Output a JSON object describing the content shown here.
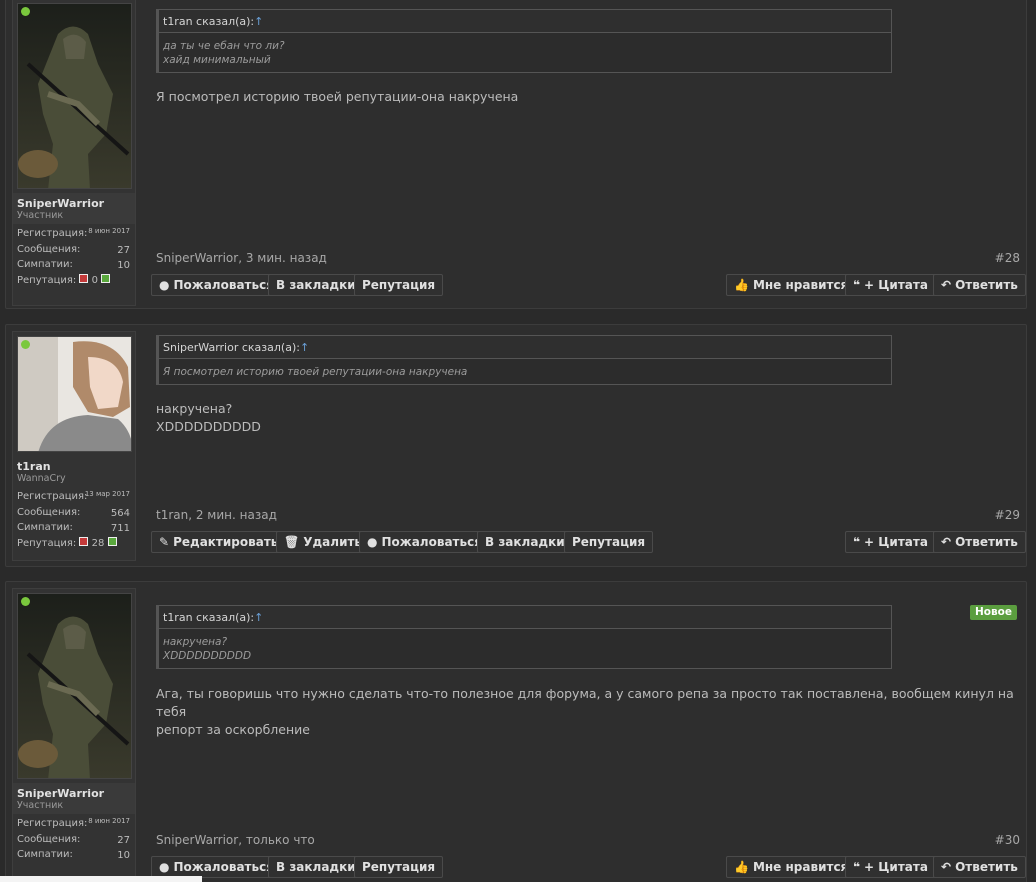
{
  "posts": [
    {
      "user": {
        "name": "SniperWarrior",
        "title": "Участник",
        "reg_label": "Регистрация:",
        "reg_date": "8 июн 2017",
        "msgs_label": "Сообщения:",
        "msgs": "27",
        "likes_label": "Симпатии:",
        "likes": "10",
        "rep_label": "Репутация:",
        "rep": "0"
      },
      "quote": {
        "author": "t1ran сказал(а):",
        "arrow": "↑",
        "lines": [
          "да ты че ебан что ли?",
          "хайд минимальный"
        ]
      },
      "message": [
        "Я посмотрел историю твоей репутации-она накручена"
      ],
      "meta": "SniperWarrior, 3 мин. назад",
      "number": "#28",
      "left_buttons": [
        "Пожаловаться",
        "В закладки",
        "Репутация"
      ],
      "right_buttons": [
        "Мне нравится",
        "+ Цитата",
        "Ответить"
      ]
    },
    {
      "user": {
        "name": "t1ran",
        "title": "WannaCry",
        "reg_label": "Регистрация:",
        "reg_date": "13 мар 2017",
        "msgs_label": "Сообщения:",
        "msgs": "564",
        "likes_label": "Симпатии:",
        "likes": "711",
        "rep_label": "Репутация:",
        "rep": "28"
      },
      "quote": {
        "author": "SniperWarrior сказал(а):",
        "arrow": "↑",
        "lines": [
          "Я посмотрел историю твоей репутации-она накручена"
        ]
      },
      "message": [
        "накручена?",
        "XDDDDDDDDDD"
      ],
      "meta": "t1ran, 2 мин. назад",
      "number": "#29",
      "left_buttons": [
        "Редактировать",
        "Удалить",
        "Пожаловаться",
        "В закладки",
        "Репутация"
      ],
      "right_buttons": [
        "+ Цитата",
        "Ответить"
      ]
    },
    {
      "user": {
        "name": "SniperWarrior",
        "title": "Участник",
        "reg_label": "Регистрация:",
        "reg_date": "8 июн 2017",
        "msgs_label": "Сообщения:",
        "msgs": "27",
        "likes_label": "Симпатии:",
        "likes": "10"
      },
      "badge": "Новое",
      "quote": {
        "author": "t1ran сказал(а):",
        "arrow": "↑",
        "lines": [
          "накручена?",
          "XDDDDDDDDDD"
        ]
      },
      "message": [
        "Ага, ты говоришь что нужно сделать что-то полезное для форума, а у самого репа за просто так поставлена, вообщем кинул на тебя",
        "репорт за оскорбление"
      ],
      "meta": "SniperWarrior, только что",
      "number": "#30",
      "left_buttons": [
        "Пожаловаться",
        "В закладки",
        "Репутация"
      ],
      "right_buttons": [
        "Мне нравится",
        "+ Цитата",
        "Ответить"
      ]
    }
  ]
}
